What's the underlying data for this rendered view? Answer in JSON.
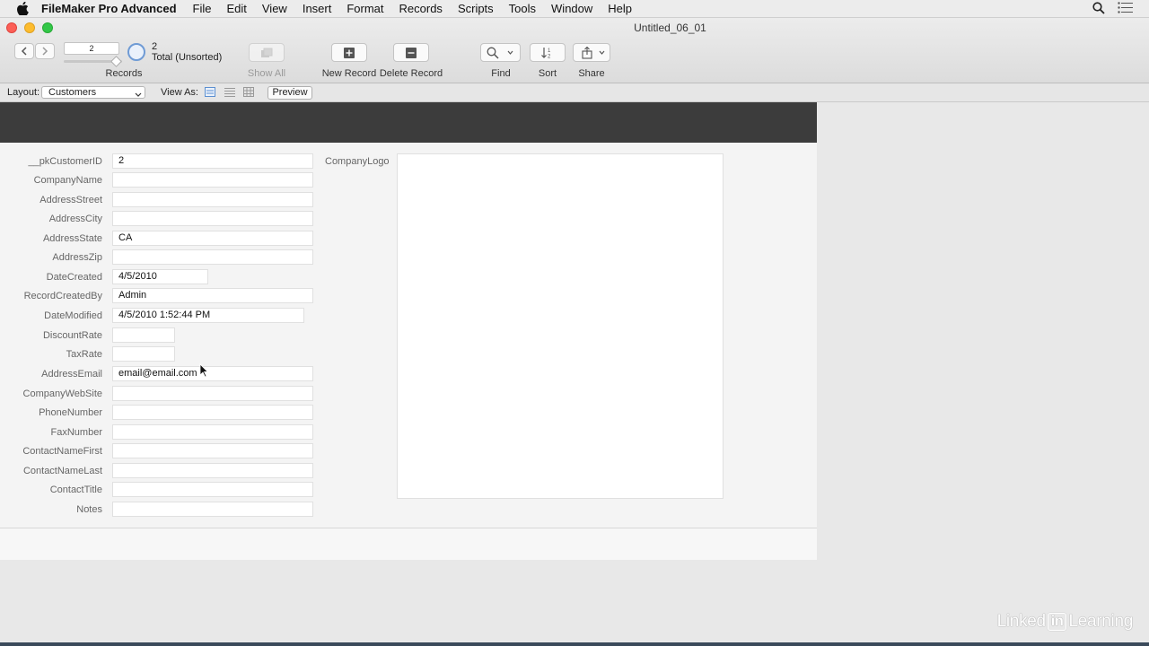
{
  "menubar": {
    "app_name": "FileMaker Pro Advanced",
    "menus": [
      "File",
      "Edit",
      "View",
      "Insert",
      "Format",
      "Records",
      "Scripts",
      "Tools",
      "Window",
      "Help"
    ]
  },
  "window": {
    "title": "Untitled_06_01"
  },
  "toolbar": {
    "record_number": "2",
    "found_count": "2",
    "total_label": "Total (Unsorted)",
    "records_label": "Records",
    "show_all_label": "Show All",
    "new_record_label": "New Record",
    "delete_record_label": "Delete Record",
    "find_label": "Find",
    "sort_label": "Sort",
    "share_label": "Share"
  },
  "layoutbar": {
    "layout_label": "Layout:",
    "layout_value": "Customers",
    "view_as_label": "View As:",
    "preview_label": "Preview"
  },
  "form": {
    "fields": [
      {
        "label": "__pkCustomerID",
        "value": "2"
      },
      {
        "label": "CompanyName",
        "value": ""
      },
      {
        "label": "AddressStreet",
        "value": ""
      },
      {
        "label": "AddressCity",
        "value": ""
      },
      {
        "label": "AddressState",
        "value": "CA"
      },
      {
        "label": "AddressZip",
        "value": ""
      },
      {
        "label": "DateCreated",
        "value": "4/5/2010"
      },
      {
        "label": "RecordCreatedBy",
        "value": "Admin"
      },
      {
        "label": "DateModified",
        "value": "4/5/2010 1:52:44 PM"
      },
      {
        "label": "DiscountRate",
        "value": ""
      },
      {
        "label": "TaxRate",
        "value": ""
      },
      {
        "label": "AddressEmail",
        "value": "email@email.com"
      },
      {
        "label": "CompanyWebSite",
        "value": ""
      },
      {
        "label": "PhoneNumber",
        "value": ""
      },
      {
        "label": "FaxNumber",
        "value": ""
      },
      {
        "label": "ContactNameFirst",
        "value": ""
      },
      {
        "label": "ContactNameLast",
        "value": ""
      },
      {
        "label": "ContactTitle",
        "value": ""
      },
      {
        "label": "Notes",
        "value": ""
      }
    ],
    "logo_label": "CompanyLogo"
  },
  "watermark": {
    "left": "Linked",
    "in": "in",
    "right": "Learning"
  },
  "colors": {
    "header_band": "#3c3c3c",
    "close": "#fc5f57",
    "minimize": "#fdbc2e",
    "zoom": "#33c748",
    "accent": "#6f9bd5"
  }
}
